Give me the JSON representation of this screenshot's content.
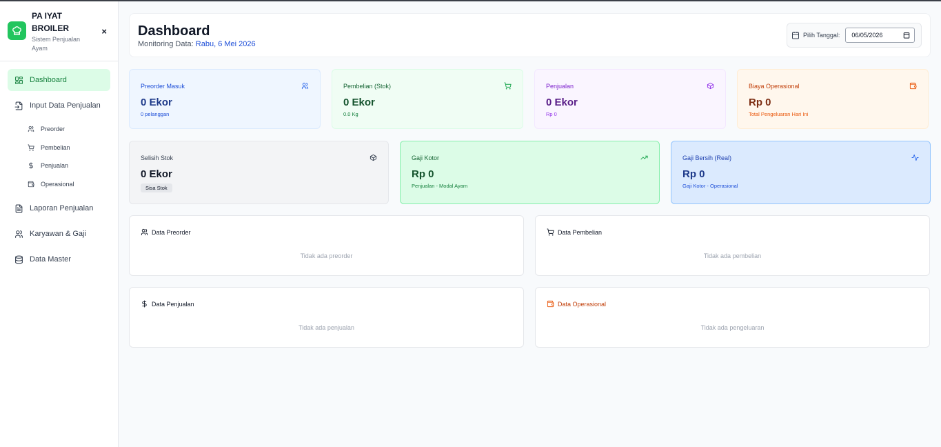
{
  "brand": {
    "title": "PA IYAT BROILER",
    "subtitle": "Sistem Penjualan Ayam",
    "close": "×"
  },
  "nav": {
    "dashboard": "Dashboard",
    "input": "Input Data Penjualan",
    "sub": {
      "preorder": "Preorder",
      "pembelian": "Pembelian",
      "penjualan": "Penjualan",
      "operasional": "Operasional"
    },
    "laporan": "Laporan Penjualan",
    "karyawan": "Karyawan & Gaji",
    "master": "Data Master"
  },
  "header": {
    "title": "Dashboard",
    "monitoring_label": "Monitoring Data:",
    "monitoring_date": "Rabu, 6 Mei 2026",
    "date_label": "Pilih Tanggal:",
    "date_value": "06/05/2026"
  },
  "cards": {
    "preorder": {
      "title": "Preorder Masuk",
      "value": "0 Ekor",
      "note": "0 pelanggan"
    },
    "pembelian": {
      "title": "Pembelian (Stok)",
      "value": "0 Ekor",
      "note": "0.0 Kg"
    },
    "penjualan": {
      "title": "Penjualan",
      "value": "0 Ekor",
      "note": "Rp 0"
    },
    "biaya": {
      "title": "Biaya Operasional",
      "value": "Rp 0",
      "note": "Total Pengeluaran Hari Ini"
    },
    "selisih": {
      "title": "Selisih Stok",
      "value": "0 Ekor",
      "badge": "Sisa Stok"
    },
    "gaji_kotor": {
      "title": "Gaji Kotor",
      "value": "Rp 0",
      "note": "Penjualan - Modal Ayam"
    },
    "gaji_bersih": {
      "title": "Gaji Bersih (Real)",
      "value": "Rp 0",
      "note": "Gaji Kotor - Operasional"
    }
  },
  "panels": {
    "preorder": {
      "title": "Data Preorder",
      "empty": "Tidak ada preorder"
    },
    "pembelian": {
      "title": "Data Pembelian",
      "empty": "Tidak ada pembelian"
    },
    "penjualan": {
      "title": "Data Penjualan",
      "empty": "Tidak ada penjualan"
    },
    "operasional": {
      "title": "Data Operasional",
      "empty": "Tidak ada pengeluaran"
    }
  },
  "colors": {
    "accent": "#22c55e",
    "active_bg": "#dcfce7",
    "link": "#1d4ed8"
  }
}
